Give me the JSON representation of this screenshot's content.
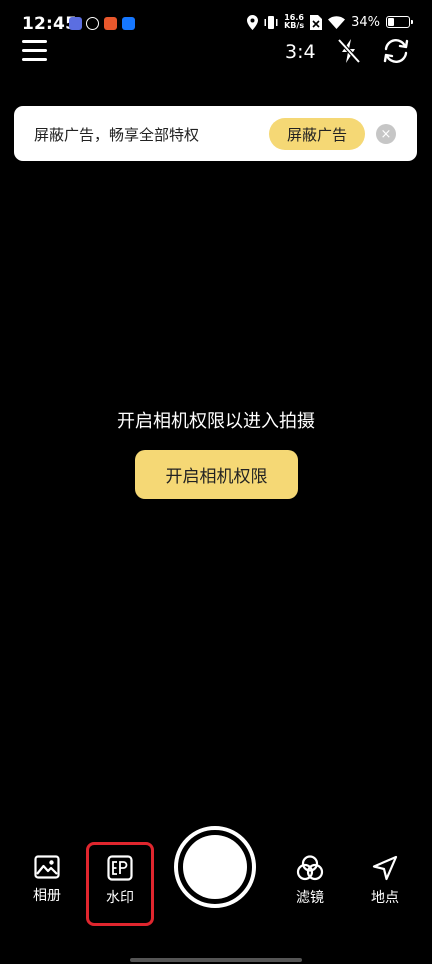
{
  "status_bar": {
    "time": "12:45",
    "net_speed_value": "16.6",
    "net_speed_unit": "KB/s",
    "battery": "34%",
    "battery_level": 0.34,
    "app_icons": [
      {
        "name": "video-app-icon",
        "color": "#5b6ee1"
      },
      {
        "name": "swirl-app-icon",
        "color": "#ffffff"
      },
      {
        "name": "red-app-icon",
        "color": "#e8572c"
      },
      {
        "name": "alipay-app-icon",
        "color": "#1677ff"
      }
    ]
  },
  "toolbar": {
    "ratio": "3:4"
  },
  "ad": {
    "text": "屏蔽广告，畅享全部特权",
    "button": "屏蔽广告",
    "close": "×"
  },
  "permission": {
    "message": "开启相机权限以进入拍摄",
    "button": "开启相机权限"
  },
  "bottom_bar": {
    "album": "相册",
    "watermark": "水印",
    "filter": "滤镜",
    "location": "地点"
  },
  "colors": {
    "accent": "#f5d875",
    "highlight": "#e0262e",
    "background": "#000000"
  }
}
